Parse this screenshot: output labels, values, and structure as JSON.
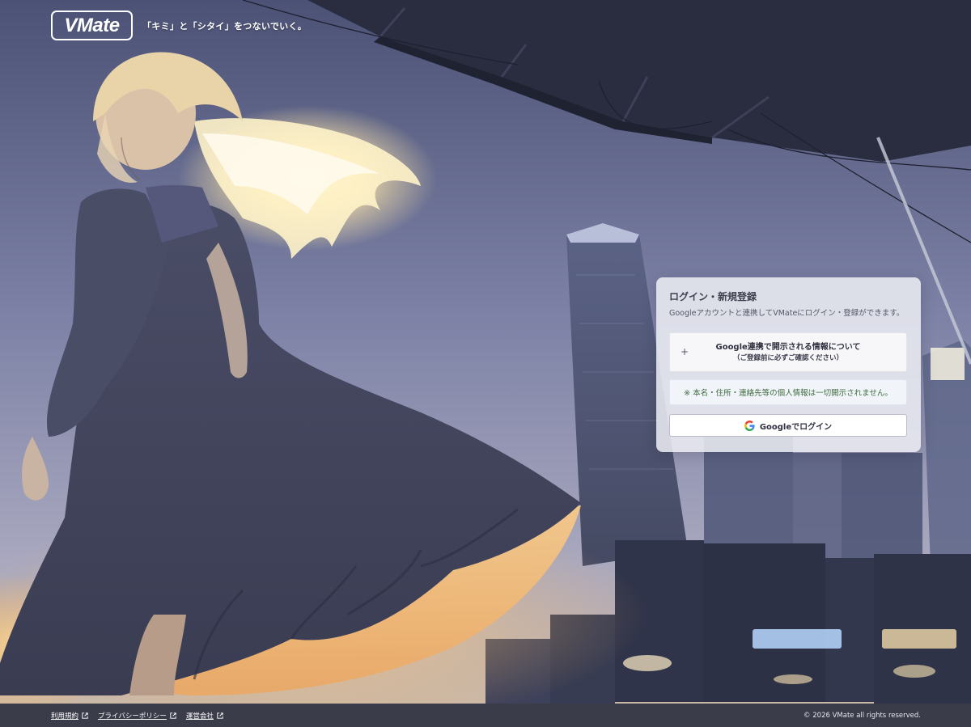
{
  "brand": {
    "logo_text": "VMate",
    "tagline": "「キミ」と「シタイ」をつないでいく。"
  },
  "login_panel": {
    "title": "ログイン・新規登録",
    "description": "Googleアカウントと連携してVMateにログイン・登録ができます。",
    "info_toggle": {
      "icon": "plus-icon",
      "symbol": "+",
      "line1": "Google連携で開示される情報について",
      "line2": "（ご登録前に必ずご確認ください）"
    },
    "notice": "※ 本名・住所・連絡先等の個人情報は一切開示されません。",
    "google_button": {
      "icon": "google-icon",
      "label": "Googleでログイン"
    }
  },
  "footer": {
    "links": [
      {
        "label": "利用規約",
        "icon": "external-link-icon"
      },
      {
        "label": "プライバシーポリシー",
        "icon": "external-link-icon"
      },
      {
        "label": "運営会社",
        "icon": "external-link-icon"
      }
    ],
    "copyright": "© 2026 VMate all rights reserved."
  },
  "colors": {
    "panel_bg": "#ecedf3",
    "notice_text": "#3f6a3f",
    "footer_bg": "#3b3c4a",
    "sky_top": "#4f5478",
    "sky_mid": "#8a8fb0",
    "glow": "#ffd890"
  }
}
